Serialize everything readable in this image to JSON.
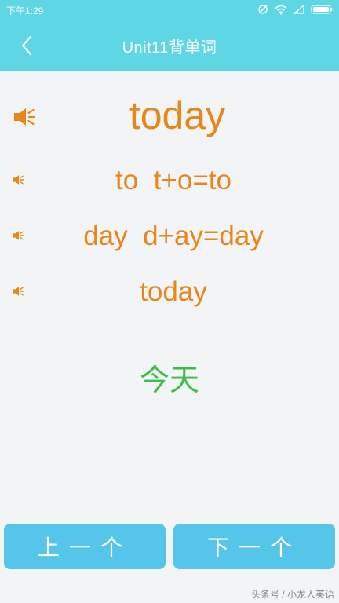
{
  "status_bar": {
    "time": "下午1:29"
  },
  "header": {
    "title": "Unit11背单词"
  },
  "word": {
    "main": "today"
  },
  "breakdown": [
    {
      "text": "to  t+o=to"
    },
    {
      "text": "day  d+ay=day"
    },
    {
      "text": "today"
    }
  ],
  "meaning": "今天",
  "buttons": {
    "prev_label": "上一个",
    "next_label": "下一个"
  },
  "watermark": "头条号 / 小龙人英语",
  "colors": {
    "header_bg": "#5ed6e3",
    "word_orange": "#e8851b",
    "meaning_green": "#3fbb4a",
    "button_blue": "#56c5ea"
  }
}
